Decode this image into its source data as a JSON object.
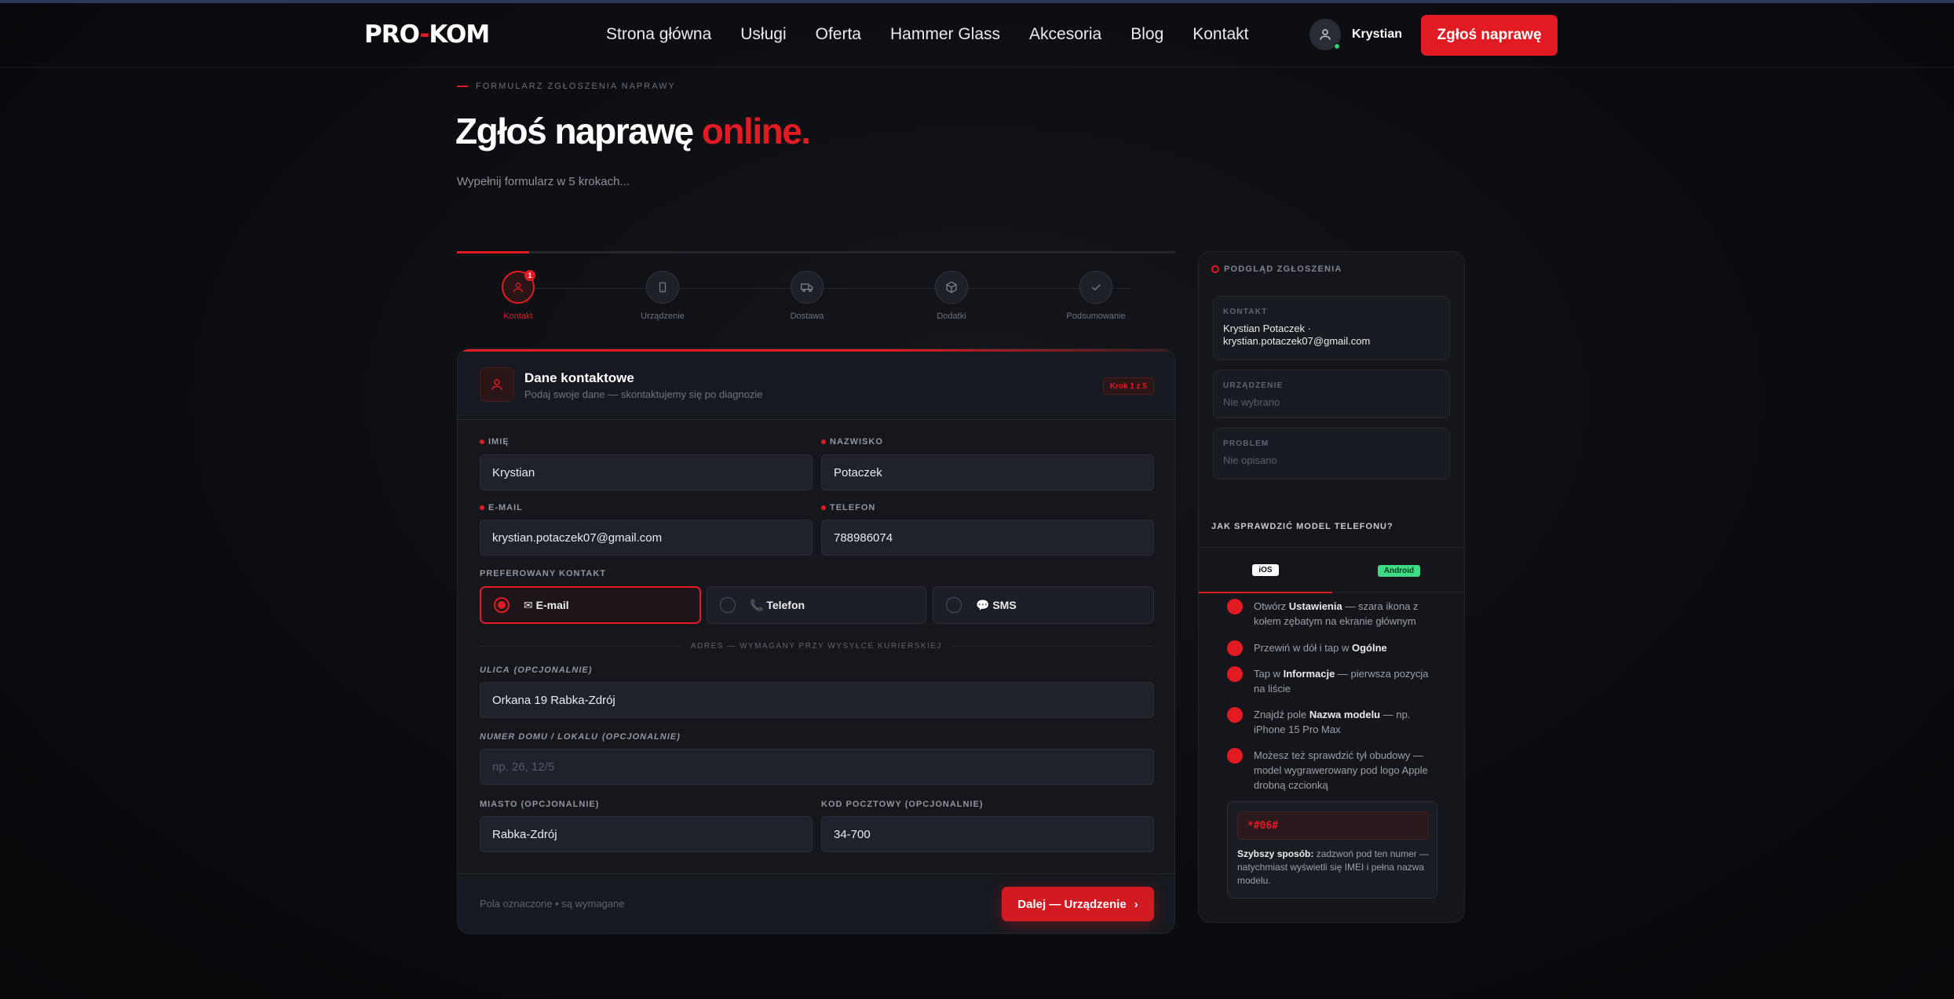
{
  "nav": {
    "logo_a": "PRO",
    "logo_b": "KOM",
    "links": [
      "Strona główna",
      "Usługi",
      "Oferta",
      "Hammer Glass",
      "Akcesoria",
      "Blog",
      "Kontakt"
    ],
    "user_name": "Krystian",
    "cta": "Zgłoś naprawę"
  },
  "hero": {
    "eyebrow": "FORMULARZ ZGŁOSZENIA NAPRAWY",
    "title": "Zgłoś naprawę",
    "title_accent": "online.",
    "subtitle": "Wypełnij formularz w 5 krokach..."
  },
  "progress_fraction": 0.1,
  "steps": [
    {
      "label": "Kontakt",
      "badge": "1",
      "icon": "user-icon"
    },
    {
      "label": "Urządzenie",
      "icon": "phone-icon"
    },
    {
      "label": "Dostawa",
      "icon": "truck-icon"
    },
    {
      "label": "Dodatki",
      "icon": "box-icon"
    },
    {
      "label": "Podsumowanie",
      "icon": "check-icon"
    }
  ],
  "form": {
    "title": "Dane kontaktowe",
    "subtitle": "Podaj swoje dane — skontaktujemy się po diagnozie",
    "step_pill": "Krok 1 z 5",
    "first_name_label": "IMIĘ",
    "first_name": "Krystian",
    "last_name_label": "NAZWISKO",
    "last_name": "Potaczek",
    "email_label": "E-MAIL",
    "email": "krystian.potaczek07@gmail.com",
    "phone_label": "TELEFON",
    "phone": "788986074",
    "pref_label": "PREFEROWANY KONTAKT",
    "pref_options": [
      "✉ E-mail",
      "📞 Telefon",
      "💬 SMS"
    ],
    "address_divider": "ADRES — WYMAGANY PRZY WYSYŁCE KURIERSKIEJ",
    "street_label": "ULICA",
    "street_opt": "(OPCJONALNIE)",
    "street": "Orkana 19 Rabka-Zdrój",
    "house_label": "NUMER DOMU / LOKALU",
    "house_opt": "(OPCJONALNIE)",
    "house_placeholder": "np. 26, 12/5",
    "city_label": "MIASTO (OPCJONALNIE)",
    "city": "Rabka-Zdrój",
    "zip_label": "KOD POCZTOWY (OPCJONALNIE)",
    "zip": "34-700",
    "foot_note": "Pola oznaczone • są wymagane",
    "next_button": "Dalej — Urządzenie",
    "next_arrow": "›"
  },
  "sidebar": {
    "title": "PODGLĄD ZGŁOSZENIA",
    "contact_key": "KONTAKT",
    "contact_value": "Krystian Potaczek · krystian.potaczek07@gmail.com",
    "device_key": "URZĄDZENIE",
    "device_value": "Nie wybrano",
    "problem_key": "PROBLEM",
    "problem_value": "Nie opisano",
    "help_question": "JAK SPRAWDZIĆ MODEL TELEFONU?",
    "tab_ios": "iOS",
    "tab_android": "Android",
    "help_steps": [
      {
        "pre": "Otwórz ",
        "bold": "Ustawienia",
        "post": " — szara ikona z kołem zębatym na ekranie głównym"
      },
      {
        "pre": "Przewiń w dół i tap w ",
        "bold": "Ogólne",
        "post": ""
      },
      {
        "pre": "Tap w ",
        "bold": "Informacje",
        "post": " — pierwsza pozycja na liście"
      },
      {
        "pre": "Znajdź pole ",
        "bold": "Nazwa modelu",
        "post": " — np. iPhone 15 Pro Max"
      },
      {
        "pre": "Możesz też sprawdzić tył obudowy — model wygrawerowany pod logo Apple drobną czcionką",
        "bold": "",
        "post": ""
      }
    ],
    "code": "*#06#",
    "code_bold": "Szybszy sposób:",
    "code_text": " zadzwoń pod ten numer — natychmiast wyświetli się IMEI i pełna nazwa modelu."
  },
  "colors": {
    "accent": "#e21b23",
    "background": "#0b0c10",
    "card": "#15171d",
    "android": "#3ddc84"
  }
}
